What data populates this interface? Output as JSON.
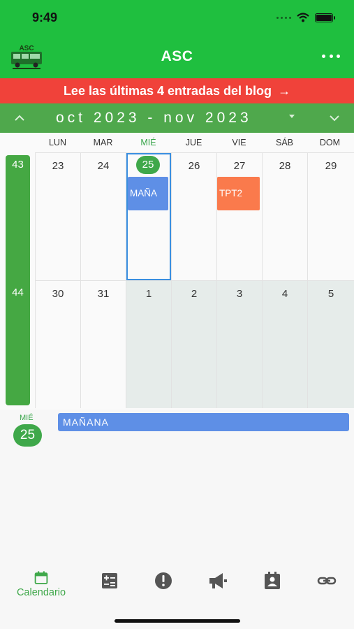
{
  "status_bar": {
    "time": "9:49"
  },
  "app_bar": {
    "title": "ASC",
    "logo_text": "ASC"
  },
  "banner": {
    "text": "Lee las últimas 4 entradas del blog",
    "arrow": "→"
  },
  "calendar_nav": {
    "range": "oct 2023 - nov 2023"
  },
  "weekdays": [
    "LUN",
    "MAR",
    "MIÉ",
    "JUE",
    "VIE",
    "SÁB",
    "DOM"
  ],
  "today_weekday_index": 2,
  "weeks": [
    {
      "number": "43",
      "days": [
        "23",
        "24",
        "25",
        "26",
        "27",
        "28",
        "29"
      ]
    },
    {
      "number": "44",
      "days": [
        "30",
        "31",
        "1",
        "2",
        "3",
        "4",
        "5"
      ]
    }
  ],
  "calendar_events": [
    {
      "label": "MAÑA",
      "day": "25",
      "color": "#5e8fe6"
    },
    {
      "label": "TPT2",
      "day": "27",
      "color": "#fa7a4c"
    }
  ],
  "agenda": {
    "weekday": "MIÉ",
    "day": "25",
    "events": [
      {
        "label": "MAÑANA",
        "color": "#5e8fe6"
      }
    ]
  },
  "tab_bar": {
    "active_label": "Calendario",
    "tabs": [
      {
        "icon": "calendar-icon",
        "label": "Calendario",
        "active": true
      },
      {
        "icon": "calculator-icon",
        "active": false
      },
      {
        "icon": "alert-icon",
        "active": false
      },
      {
        "icon": "megaphone-icon",
        "active": false
      },
      {
        "icon": "contact-card-icon",
        "active": false
      },
      {
        "icon": "link-icon",
        "active": false
      }
    ]
  },
  "colors": {
    "header_green": "#1fbf3f",
    "nav_green": "#4fa84c",
    "banner_red": "#f0423a",
    "today_blue_border": "#3a8fe0",
    "active_tab_green": "#3fa84a",
    "inactive_icon": "#555555"
  }
}
